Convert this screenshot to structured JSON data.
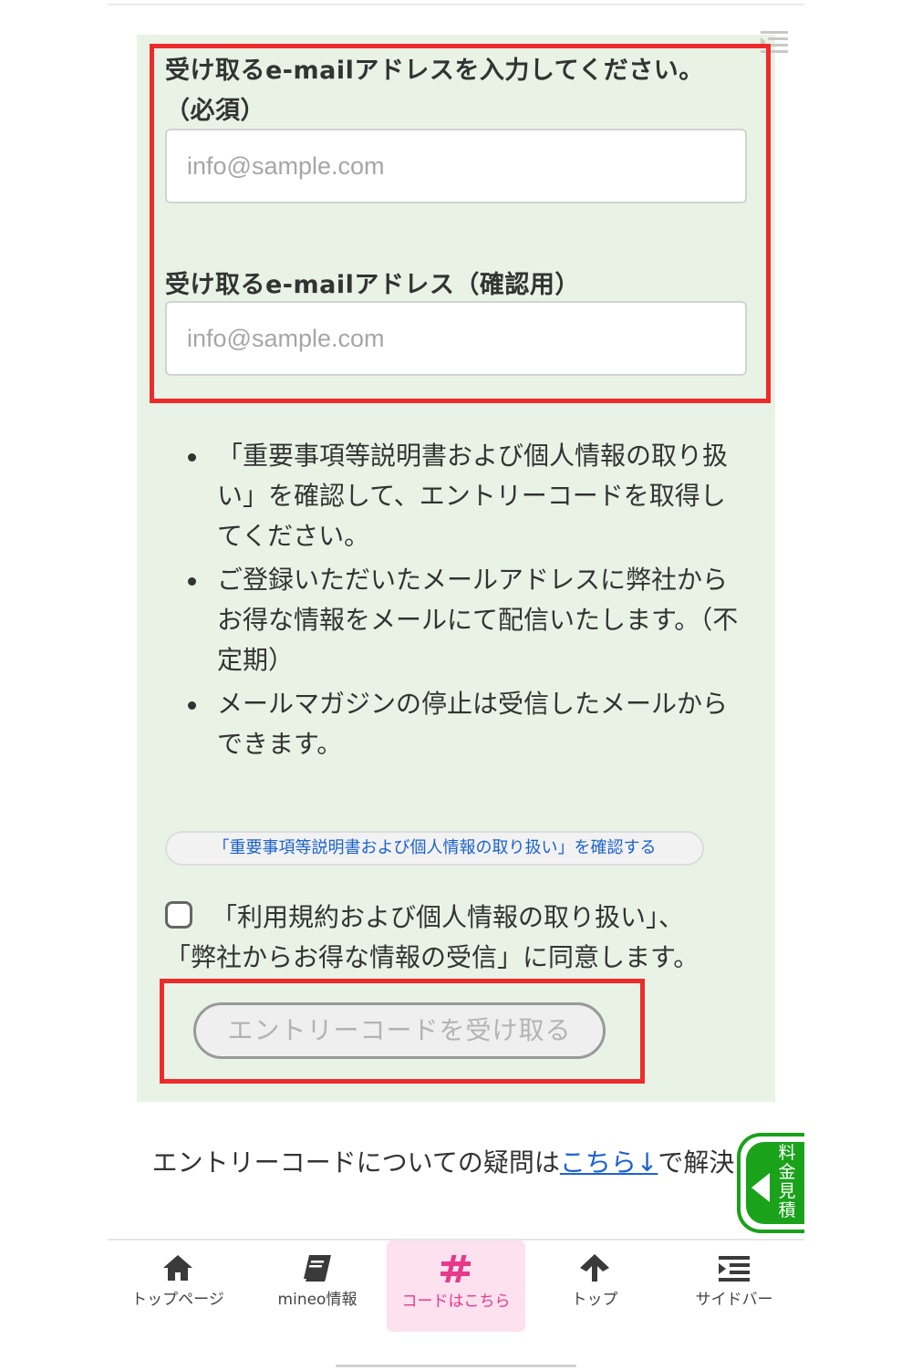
{
  "form": {
    "email_label": "受け取るe-mailアドレスを入力してください。（必須）",
    "email_placeholder": "info@sample.com",
    "email_confirm_label": "受け取るe-mailアドレス（確認用）",
    "email_confirm_placeholder": "info@sample.com"
  },
  "notes": [
    "「重要事項等説明書および個人情報の取り扱い」を確認して、エントリーコードを取得してください。",
    "ご登録いただいたメールアドレスに弊社からお得な情報をメールにて配信いたします。（不定期）",
    "メールマガジンの停止は受信したメールからできます。"
  ],
  "confirm_link": "「重要事項等説明書および個人情報の取り扱い」を確認する",
  "agreement": {
    "checked": false,
    "line1": "「利用規約および個人情報の取り扱い」、",
    "line2": "「弊社からお得な情報の受信」に同意します。"
  },
  "entry_button": "エントリーコードを受け取る",
  "faq": {
    "prefix": "エントリーコードについての疑問は",
    "link": "こちら↓",
    "suffix": "で解決！"
  },
  "side_tab": "料金見積",
  "colors": {
    "panel_bg": "#e8f3e6",
    "highlight_red": "#ee2b2b",
    "link_blue": "#1b62d0",
    "active_pink": "#e8388a",
    "side_tab_green": "#1aa21a"
  },
  "bottom_nav": [
    {
      "label": "トップページ",
      "icon": "home-icon"
    },
    {
      "label": "mineo情報",
      "icon": "book-icon"
    },
    {
      "label": "コードはこちら",
      "icon": "hash-icon",
      "active": true
    },
    {
      "label": "トップ",
      "icon": "arrow-up-icon"
    },
    {
      "label": "サイドバー",
      "icon": "sidebar-icon"
    }
  ]
}
